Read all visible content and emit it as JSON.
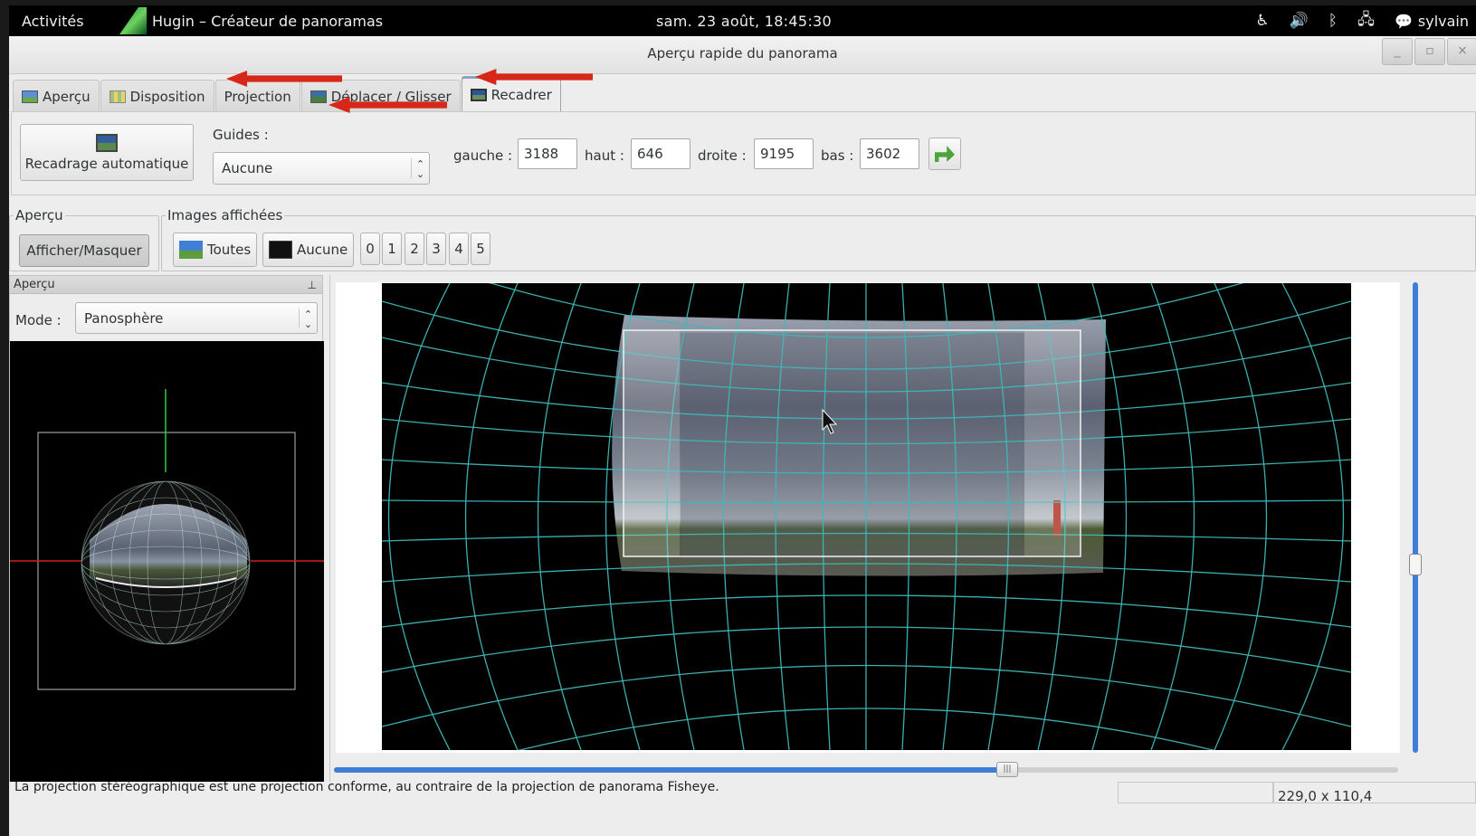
{
  "topbar": {
    "activities": "Activités",
    "app_name": "Hugin – Créateur de panoramas",
    "clock": "sam. 23 août, 18:45:30",
    "user": "sylvain"
  },
  "window": {
    "title": "Aperçu rapide du panorama",
    "min": "_",
    "max": "▫",
    "close": "×"
  },
  "tabs": [
    {
      "label": "Aperçu"
    },
    {
      "label": "Disposition"
    },
    {
      "label": "Projection"
    },
    {
      "label": "Déplacer / Glisser"
    },
    {
      "label": "Recadrer"
    }
  ],
  "crop": {
    "autocrop_label": "Recadrage automatique",
    "guides_label": "Guides :",
    "guides_value": "Aucune",
    "left_label": "gauche :",
    "left_value": "3188",
    "top_label": "haut :",
    "top_value": "646",
    "right_label": "droite :",
    "right_value": "9195",
    "bottom_label": "bas :",
    "bottom_value": "3602"
  },
  "preview_group": {
    "title": "Aperçu",
    "toggle_label": "Afficher/Masquer"
  },
  "images_group": {
    "title": "Images affichées",
    "all_label": "Toutes",
    "none_label": "Aucune",
    "numbers": [
      "0",
      "1",
      "2",
      "3",
      "4",
      "5"
    ]
  },
  "left_pane": {
    "header": "Aperçu",
    "pin": "⊥",
    "mode_label": "Mode :",
    "mode_value": "Panosphère"
  },
  "status": {
    "message": "La projection stéréographique est une projection conforme, au contraire de la projection de panorama Fisheye.",
    "coords": "229,0 x 110,4"
  },
  "colors": {
    "grid": "#3fb8b8",
    "accent": "#3e7ed6",
    "annotation": "#d62718"
  }
}
